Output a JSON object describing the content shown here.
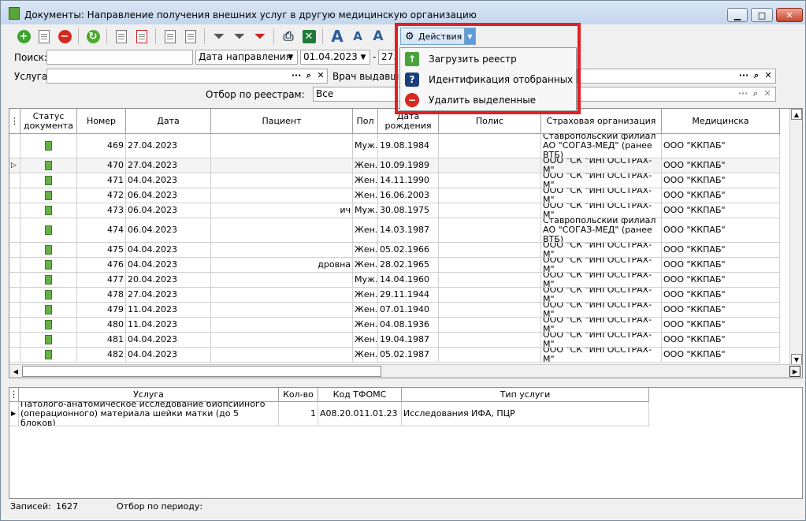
{
  "window": {
    "title": "Документы: Направление получения внешних услуг в другую медицинскую организацию"
  },
  "toolbar": {
    "actions_label": "Действия",
    "icons": [
      "add-icon",
      "edit-document-icon",
      "delete-icon",
      "refresh-icon",
      "sign-icon",
      "unsign-icon",
      "copy-icon",
      "paste-icon",
      "filter-icon",
      "edit-filter-icon",
      "clear-filter-icon",
      "print-icon",
      "excel-icon",
      "font-increase-icon",
      "font-decrease-icon",
      "font-default-icon",
      "gear-icon"
    ]
  },
  "filters": {
    "search_label": "Поиск:",
    "date_type": "Дата направления",
    "date_from": "01.04.2023",
    "date_sep": "-",
    "date_to": "27.",
    "service_label": "Услуга:",
    "doctor_label": "Врач выдавши",
    "registry_label": "Отбор по реестрам:",
    "registry_value": "Все",
    "dots": "···"
  },
  "menu": {
    "items": [
      {
        "label": "Загрузить реестр",
        "icon": "upload-registry-icon"
      },
      {
        "label": "Идентификация отобранных",
        "icon": "question-icon"
      },
      {
        "label": "Удалить выделенные",
        "icon": "delete-icon"
      }
    ]
  },
  "grid": {
    "columns": [
      "Статус документа",
      "Номер",
      "Дата",
      "Пациент",
      "Пол",
      "Дата рождения",
      "Полис",
      "Страховая организация",
      "Медицинска"
    ],
    "rows": [
      {
        "number": "469",
        "date": "27.04.2023",
        "patient": "",
        "sex": "Муж.",
        "dob": "19.08.1984",
        "insurer": "Ставропольский филиал АО \"СОГАЗ-МЕД\" (ранее ВТБ)",
        "org": "ООО \"ККПАБ\""
      },
      {
        "number": "470",
        "date": "27.04.2023",
        "patient": "",
        "sex": "Жен.",
        "dob": "10.09.1989",
        "insurer": "ООО \"СК \"ИНГОССТРАХ-М\"",
        "org": "ООО \"ККПАБ\""
      },
      {
        "number": "471",
        "date": "04.04.2023",
        "patient": "",
        "sex": "Жен.",
        "dob": "14.11.1990",
        "insurer": "ООО \"СК \"ИНГОССТРАХ-М\"",
        "org": "ООО \"ККПАБ\""
      },
      {
        "number": "472",
        "date": "06.04.2023",
        "patient": "",
        "sex": "Жен.",
        "dob": "16.06.2003",
        "insurer": "ООО \"СК \"ИНГОССТРАХ-М\"",
        "org": "ООО \"ККПАБ\""
      },
      {
        "number": "473",
        "date": "06.04.2023",
        "patient": "ич",
        "sex": "Муж.",
        "dob": "30.08.1975",
        "insurer": "ООО \"СК \"ИНГОССТРАХ-М\"",
        "org": "ООО \"ККПАБ\""
      },
      {
        "number": "474",
        "date": "06.04.2023",
        "patient": "",
        "sex": "Жен.",
        "dob": "14.03.1987",
        "insurer": "Ставропольский филиал АО \"СОГАЗ-МЕД\" (ранее ВТБ)",
        "org": "ООО \"ККПАБ\""
      },
      {
        "number": "475",
        "date": "04.04.2023",
        "patient": "",
        "sex": "Жен.",
        "dob": "05.02.1966",
        "insurer": "ООО \"СК \"ИНГОССТРАХ-М\"",
        "org": "ООО \"ККПАБ\""
      },
      {
        "number": "476",
        "date": "04.04.2023",
        "patient": "дровна",
        "sex": "Жен.",
        "dob": "28.02.1965",
        "insurer": "ООО \"СК \"ИНГОССТРАХ-М\"",
        "org": "ООО \"ККПАБ\""
      },
      {
        "number": "477",
        "date": "20.04.2023",
        "patient": "",
        "sex": "Муж.",
        "dob": "14.04.1960",
        "insurer": "ООО \"СК \"ИНГОССТРАХ-М\"",
        "org": "ООО \"ККПАБ\""
      },
      {
        "number": "478",
        "date": "27.04.2023",
        "patient": "",
        "sex": "Жен.",
        "dob": "29.11.1944",
        "insurer": "ООО \"СК \"ИНГОССТРАХ-М\"",
        "org": "ООО \"ККПАБ\""
      },
      {
        "number": "479",
        "date": "11.04.2023",
        "patient": "",
        "sex": "Жен.",
        "dob": "07.01.1940",
        "insurer": "ООО \"СК \"ИНГОССТРАХ-М\"",
        "org": "ООО \"ККПАБ\""
      },
      {
        "number": "480",
        "date": "11.04.2023",
        "patient": "",
        "sex": "Жен.",
        "dob": "04.08.1936",
        "insurer": "ООО \"СК \"ИНГОССТРАХ-М\"",
        "org": "ООО \"ККПАБ\""
      },
      {
        "number": "481",
        "date": "04.04.2023",
        "patient": "",
        "sex": "Жен.",
        "dob": "19.04.1987",
        "insurer": "ООО \"СК \"ИНГОССТРАХ-М\"",
        "org": "ООО \"ККПАБ\""
      },
      {
        "number": "482",
        "date": "04.04.2023",
        "patient": "",
        "sex": "Жен.",
        "dob": "05.02.1987",
        "insurer": "ООО \"СК \"ИНГОССТРАХ-М\"",
        "org": "ООО \"ККПАБ\""
      }
    ]
  },
  "detail": {
    "columns": [
      "Услуга",
      "Кол-во",
      "Код ТФОМС",
      "Тип услуги"
    ],
    "rows": [
      {
        "service": "Патолого-анатомическое исследование биопсийного (операционного) материала шейки матки (до 5 блоков)",
        "qty": "1",
        "code": "A08.20.011.01.23",
        "type": "Исследования ИФА, ПЦР"
      }
    ]
  },
  "status": {
    "records_label": "Записей:",
    "records_value": "1627",
    "period_label": "Отбор по периоду:"
  },
  "colors": {
    "highlight": "#e31e25",
    "status_icon": "#64b245"
  }
}
